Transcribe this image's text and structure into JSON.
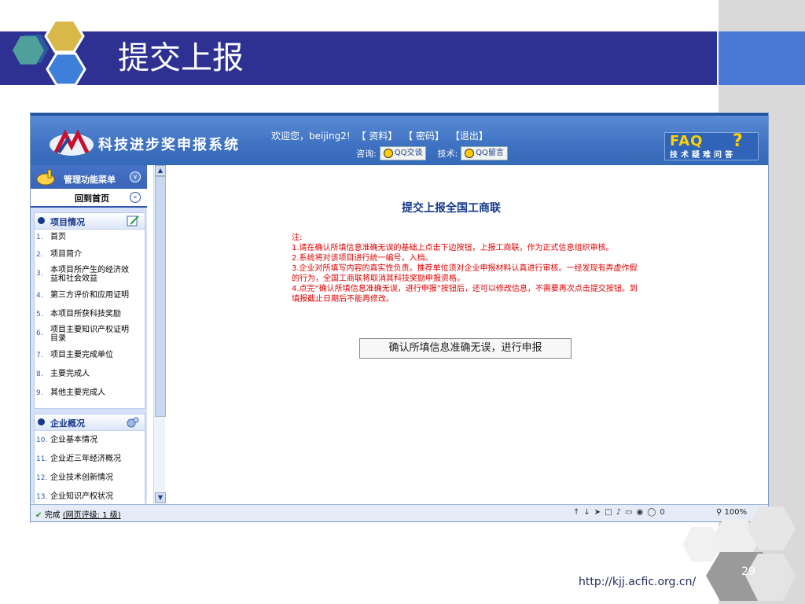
{
  "slide": {
    "title": "提交上报",
    "footer_url": "http://kjj.acfic.org.cn/",
    "page_number": "29"
  },
  "app": {
    "brand_name": "科技进步奖申报系统",
    "welcome": "欢迎您，beijing2!",
    "top_links": [
      "【 资料】",
      "【 密码】",
      "【退出】"
    ],
    "consult_label": "咨询:",
    "qq_chat_label": "QQ交谈",
    "tech_label": "技术:",
    "qq_message_label": "QQ留言",
    "faq_title": "FAQ",
    "faq_subtitle": "技术疑难问答"
  },
  "sidebar": {
    "menu_title": "管理功能菜单",
    "home_label": "回到首页",
    "groups": [
      {
        "title": "项目情况",
        "items": [
          {
            "num": "1.",
            "label": "首页"
          },
          {
            "num": "2.",
            "label": "项目简介"
          },
          {
            "num": "3.",
            "label": "本项目所产生的经济效益和社会效益"
          },
          {
            "num": "4.",
            "label": "第三方评价和应用证明"
          },
          {
            "num": "5.",
            "label": "本项目所获科技奖励"
          },
          {
            "num": "6.",
            "label": "项目主要知识产权证明目录"
          },
          {
            "num": "7.",
            "label": "项目主要完成单位"
          },
          {
            "num": "8.",
            "label": "主要完成人"
          },
          {
            "num": "9.",
            "label": "其他主要完成人"
          }
        ]
      },
      {
        "title": "企业概况",
        "items": [
          {
            "num": "10.",
            "label": "企业基本情况"
          },
          {
            "num": "11.",
            "label": "企业近三年经济概况"
          },
          {
            "num": "12.",
            "label": "企业技术创新情况"
          },
          {
            "num": "13.",
            "label": "企业知识产权状况"
          }
        ]
      }
    ]
  },
  "main": {
    "title": "提交上报全国工商联",
    "notes_heading": "注:",
    "notes": [
      "1.请在确认所填信息准确无误的基础上点击下边按钮，上报工商联，作为正式信息组织审核。",
      "2.系统将对该项目进行统一编号，入档。",
      "3.企业对所填写内容的真实性负责。推荐单位须对企业申报材料认真进行审核。一经发现有弄虚作假的行为，全国工商联将取消其科技奖励申报资格。",
      "4.点完“确认所填信息准确无误，进行申报”按钮后，还可以修改信息，不需要再次点击提交按钮。到填报截止日期后不能再修改。"
    ],
    "submit_label": "确认所填信息准确无误，进行申报"
  },
  "statusbar": {
    "done_label": "完成",
    "rating_label": "(网页评级: 1 级)",
    "count": "0",
    "zoom": "100%"
  },
  "colors": {
    "title_bar": "#2e3192",
    "accent_blue": "#4a78d6",
    "note_red": "#e00000",
    "link_blue": "#15398c"
  }
}
